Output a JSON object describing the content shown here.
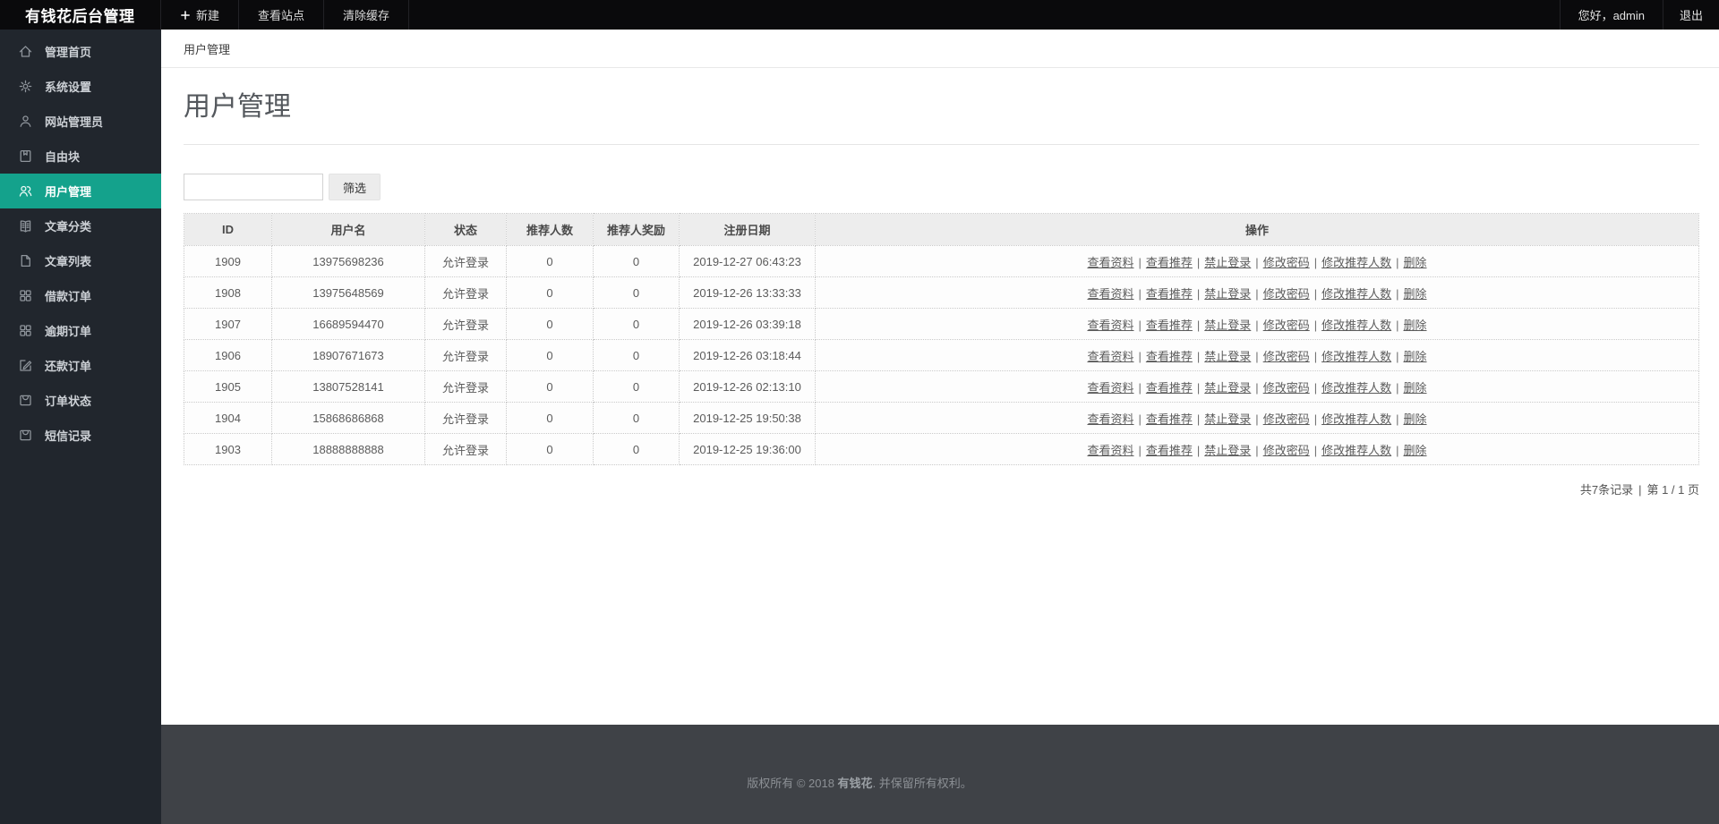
{
  "topbar": {
    "brand": "有钱花后台管理",
    "nav_items": [
      {
        "name": "new",
        "label": "新建",
        "icon": "plus-icon"
      },
      {
        "name": "view-site",
        "label": "查看站点"
      },
      {
        "name": "clear-cache",
        "label": "清除缓存"
      }
    ],
    "greeting": "您好，admin",
    "logout_label": "退出"
  },
  "sidebar": {
    "items": [
      {
        "name": "home",
        "label": "管理首页",
        "icon": "home-icon",
        "active": false
      },
      {
        "name": "system-settings",
        "label": "系统设置",
        "icon": "gear-icon",
        "active": false
      },
      {
        "name": "site-admins",
        "label": "网站管理员",
        "icon": "admin-user-icon",
        "active": false
      },
      {
        "name": "free-blocks",
        "label": "自由块",
        "icon": "bookmark-block-icon",
        "active": false
      },
      {
        "name": "user-management",
        "label": "用户管理",
        "icon": "users-icon",
        "active": true
      },
      {
        "name": "article-categories",
        "label": "文章分类",
        "icon": "open-book-icon",
        "active": false
      },
      {
        "name": "article-list",
        "label": "文章列表",
        "icon": "file-icon",
        "active": false
      },
      {
        "name": "loan-orders",
        "label": "借款订单",
        "icon": "grid-icon",
        "active": false
      },
      {
        "name": "overdue-orders",
        "label": "逾期订单",
        "icon": "grid-icon",
        "active": false
      },
      {
        "name": "repayment-orders",
        "label": "还款订单",
        "icon": "edit-square-icon",
        "active": false
      },
      {
        "name": "order-status",
        "label": "订单状态",
        "icon": "tray-box-icon",
        "active": false
      },
      {
        "name": "sms-records",
        "label": "短信记录",
        "icon": "tray-box-icon",
        "active": false
      }
    ]
  },
  "breadcrumb": "用户管理",
  "page": {
    "title": "用户管理"
  },
  "filter": {
    "input_value": "",
    "button_label": "筛选"
  },
  "table": {
    "headers": [
      "ID",
      "用户名",
      "状态",
      "推荐人数",
      "推荐人奖励",
      "注册日期",
      "操作"
    ],
    "action_labels": [
      "查看资料",
      "查看推荐",
      "禁止登录",
      "修改密码",
      "修改推荐人数",
      "删除"
    ],
    "rows": [
      {
        "id": "1909",
        "username": "13975698236",
        "status": "允许登录",
        "referrals": "0",
        "referral_reward": "0",
        "register_date": "2019-12-27 06:43:23"
      },
      {
        "id": "1908",
        "username": "13975648569",
        "status": "允许登录",
        "referrals": "0",
        "referral_reward": "0",
        "register_date": "2019-12-26 13:33:33"
      },
      {
        "id": "1907",
        "username": "16689594470",
        "status": "允许登录",
        "referrals": "0",
        "referral_reward": "0",
        "register_date": "2019-12-26 03:39:18"
      },
      {
        "id": "1906",
        "username": "18907671673",
        "status": "允许登录",
        "referrals": "0",
        "referral_reward": "0",
        "register_date": "2019-12-26 03:18:44"
      },
      {
        "id": "1905",
        "username": "13807528141",
        "status": "允许登录",
        "referrals": "0",
        "referral_reward": "0",
        "register_date": "2019-12-26 02:13:10"
      },
      {
        "id": "1904",
        "username": "15868686868",
        "status": "允许登录",
        "referrals": "0",
        "referral_reward": "0",
        "register_date": "2019-12-25 19:50:38"
      },
      {
        "id": "1903",
        "username": "18888888888",
        "status": "允许登录",
        "referrals": "0",
        "referral_reward": "0",
        "register_date": "2019-12-25 19:36:00"
      }
    ]
  },
  "pagination": {
    "records": "共7条记录",
    "separator": "|",
    "page": "第 1 / 1 页"
  },
  "footer": {
    "prefix": "版权所有 © 2018 ",
    "brand": "有钱花",
    "suffix": ". 并保留所有权利。"
  },
  "colors": {
    "accent": "#14a28c",
    "topbar_bg": "#0a0a0c",
    "sidebar_bg": "#21262d",
    "footer_bg": "#3f4247",
    "table_header_bg": "#ededed"
  }
}
